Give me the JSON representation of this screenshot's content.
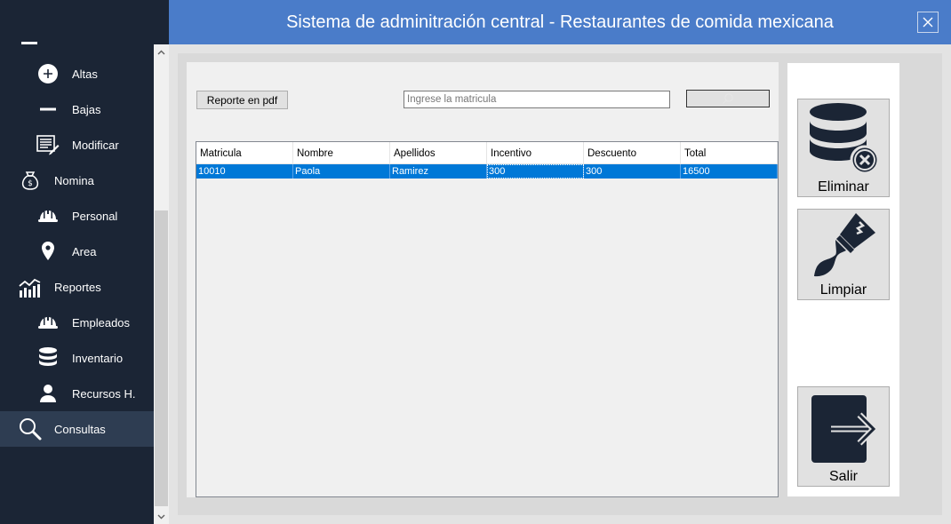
{
  "window": {
    "title": "Sistema de adminitración central - Restaurantes de comida mexicana",
    "close_icon": "close-icon"
  },
  "sidebar": {
    "items": [
      {
        "label": "Altas",
        "icon": "plus-circle-icon",
        "level": "sub"
      },
      {
        "label": "Bajas",
        "icon": "minus-icon",
        "level": "sub"
      },
      {
        "label": "Modificar",
        "icon": "edit-list-icon",
        "level": "sub"
      },
      {
        "label": "Nomina",
        "icon": "money-bag-icon",
        "level": "top"
      },
      {
        "label": "Personal",
        "icon": "hardhat-icon",
        "level": "sub"
      },
      {
        "label": "Area",
        "icon": "map-pin-icon",
        "level": "sub"
      },
      {
        "label": "Reportes",
        "icon": "chart-icon",
        "level": "top"
      },
      {
        "label": "Empleados",
        "icon": "hardhat-icon",
        "level": "sub"
      },
      {
        "label": "Inventario",
        "icon": "database-icon",
        "level": "sub"
      },
      {
        "label": "Recursos H.",
        "icon": "user-icon",
        "level": "sub"
      },
      {
        "label": "Consultas",
        "icon": "search-icon",
        "level": "top",
        "active": true
      }
    ]
  },
  "toolbar": {
    "pdf_label": "Reporte en pdf",
    "search_placeholder": "Ingrese la matricula",
    "search_value": ""
  },
  "table": {
    "columns": [
      "Matricula",
      "Nombre",
      "Apellidos",
      "Incentivo",
      "Descuento",
      "Total"
    ],
    "rows": [
      [
        "10010",
        "Paola",
        "Ramirez",
        "300",
        "300",
        "16500"
      ]
    ]
  },
  "actions": {
    "delete_label": "Eliminar",
    "clear_label": "Limpiar",
    "exit_label": "Salir"
  },
  "colors": {
    "titlebar": "#4a7cc9",
    "sidebar": "#1b2535",
    "selection": "#0078d7"
  }
}
